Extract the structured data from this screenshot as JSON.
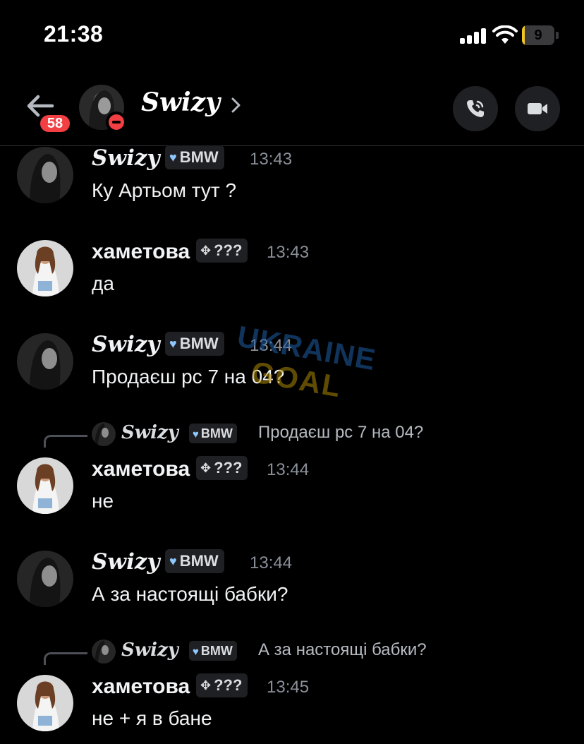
{
  "status_bar": {
    "time": "21:38",
    "battery_percent": "9",
    "battery_level": 0.09
  },
  "header": {
    "back_badge": "58",
    "channel_name": "Swizy",
    "user_status": "do-not-disturb"
  },
  "icons": {
    "back": "arrow-left-icon",
    "chevron": "chevron-right-icon",
    "call": "phone-call-icon",
    "video": "video-camera-icon"
  },
  "colors": {
    "background": "#000000",
    "badge": "#f23f43",
    "tag_bg": "#1f2023",
    "heart": "#8ec8ff",
    "timestamp": "#8a8f98"
  },
  "messages": [
    {
      "author": "Swizy",
      "tag": "BMW",
      "tag_icon": "heart",
      "time": "13:43",
      "text": "Ку Артьом тут ?"
    },
    {
      "author": "хаметова",
      "tag": "???",
      "tag_icon": "diamond",
      "time": "13:43",
      "text": "да"
    },
    {
      "author": "Swizy",
      "tag": "BMW",
      "tag_icon": "heart",
      "time": "13:44",
      "text": "Продаєш рс 7 на 04?"
    },
    {
      "reply": {
        "author": "Swizy",
        "tag": "BMW",
        "text": "Продаєш рс 7 на 04?"
      },
      "author": "хаметова",
      "tag": "???",
      "tag_icon": "diamond",
      "time": "13:44",
      "text": "не"
    },
    {
      "author": "Swizy",
      "tag": "BMW",
      "tag_icon": "heart",
      "time": "13:44",
      "text": "А за настоящі бабки?"
    },
    {
      "reply": {
        "author": "Swizy",
        "tag": "BMW",
        "text": "А за настоящі бабки?"
      },
      "author": "хаметова",
      "tag": "???",
      "tag_icon": "diamond",
      "time": "13:45",
      "text": "не + я в бане"
    }
  ],
  "watermark": {
    "line1": "UKRAINE",
    "line2": "GOAL"
  }
}
